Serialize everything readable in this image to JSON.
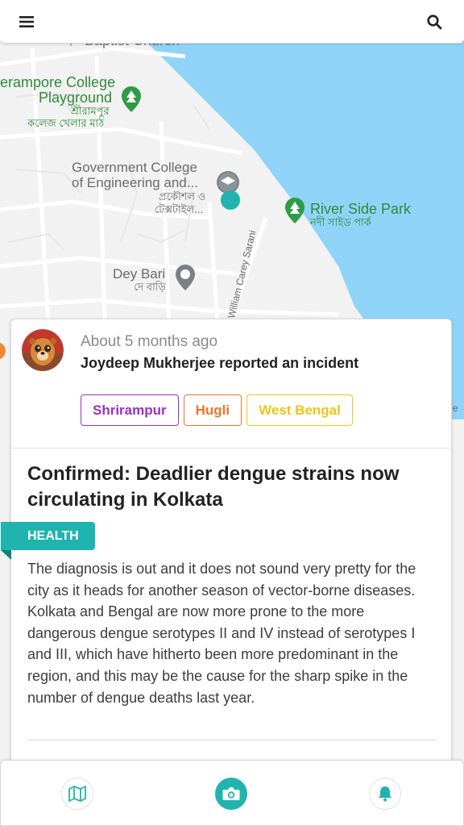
{
  "map": {
    "poi_baptist": "Baptist Church",
    "poi_playground_en_1": "erampore College",
    "poi_playground_en_2": "Playground",
    "poi_playground_bn_1": "শ্রীরামপুর",
    "poi_playground_bn_2": "কলেজ খেলার মাঠ",
    "poi_college_en_1": "Government College",
    "poi_college_en_2": "of Engineering and...",
    "poi_college_bn_1": "প্রকৌশল ও",
    "poi_college_bn_2": "টেক্সটাইল...",
    "poi_park_en": "River Side Park",
    "poi_park_bn": "নদী সাইড পার্ক",
    "poi_deybari_en": "Dey Bari",
    "poi_deybari_bn": "দে বাড়ি",
    "road_name": "William Carey Sarani",
    "edge_letter": "e"
  },
  "header": {
    "menu_icon": "hamburger-menu-icon",
    "search_icon": "search-icon"
  },
  "card": {
    "time": "About 5 months ago",
    "reporter": "Joydeep Mukherjee reported an incident",
    "tags": [
      {
        "label": "Shrirampur",
        "color": "#9b2fc0"
      },
      {
        "label": "Hugli",
        "color": "#e8762c"
      },
      {
        "label": "West Bengal",
        "color": "#f0c419"
      }
    ],
    "title": "Confirmed: Deadlier dengue strains now circulating in Kolkata",
    "category": "HEALTH",
    "body": "The diagnosis is out and it does not sound very pretty for the city as it heads for another season of vector-borne diseases. Kolkata and Bengal are now more prone to the more dangerous dengue serotypes II and IV instead of serotypes I and III, which have hitherto been more predominant in the region, and this may be the cause for the sharp spike in the number of dengue deaths last year."
  },
  "bottom_nav": {
    "map_icon": "map-icon",
    "camera_icon": "camera-icon",
    "bell_icon": "bell-icon"
  },
  "colors": {
    "accent": "#21b4ae",
    "water": "#8fd4f8",
    "map_green": "#2e8b3a"
  }
}
